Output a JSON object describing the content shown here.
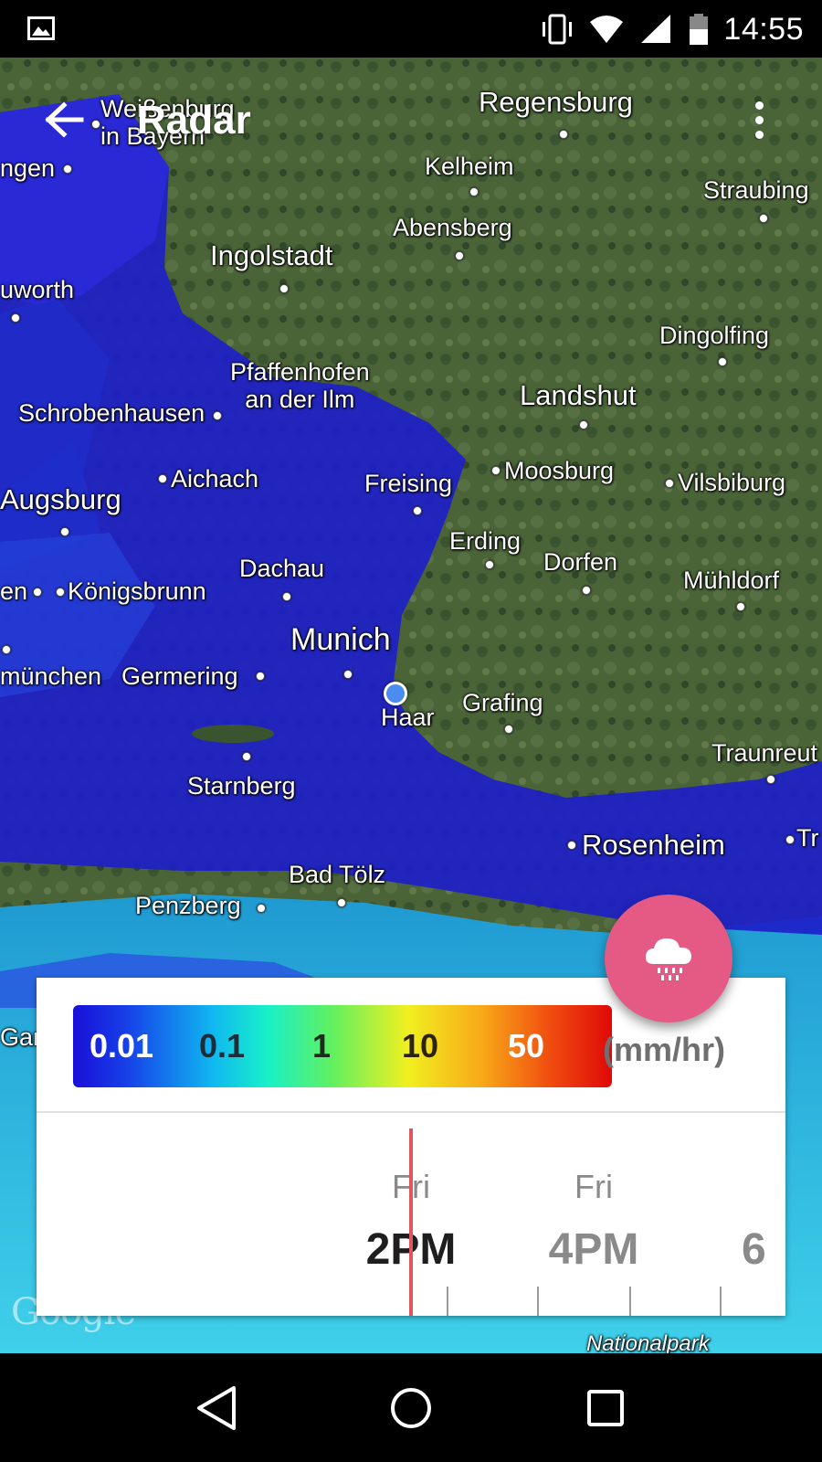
{
  "status_bar": {
    "time": "14:55",
    "icons": [
      "image-icon",
      "vibrate-icon",
      "wifi-icon",
      "signal-icon",
      "battery-icon"
    ]
  },
  "app_bar": {
    "title": "Radar",
    "back_icon": "arrow-left-icon",
    "menu_icon": "more-vert-icon"
  },
  "map": {
    "places": [
      {
        "id": "weissenburg",
        "label": "Weißenburg\nin Bayern"
      },
      {
        "id": "regensburg",
        "label": "Regensburg"
      },
      {
        "id": "kelheim",
        "label": "Kelheim"
      },
      {
        "id": "straubing",
        "label": "Straubing"
      },
      {
        "id": "ngen",
        "label": "ngen"
      },
      {
        "id": "abensberg",
        "label": "Abensberg"
      },
      {
        "id": "ingolstadt",
        "label": "Ingolstadt"
      },
      {
        "id": "uworth",
        "label": "uworth"
      },
      {
        "id": "dingolfing",
        "label": "Dingolfing"
      },
      {
        "id": "pfaffenhofen",
        "label": "Pfaffenhofen\nan der Ilm"
      },
      {
        "id": "landshut",
        "label": "Landshut"
      },
      {
        "id": "schrobenhausen",
        "label": "Schrobenhausen"
      },
      {
        "id": "aichach",
        "label": "Aichach"
      },
      {
        "id": "freising",
        "label": "Freising"
      },
      {
        "id": "moosburg",
        "label": "Moosburg"
      },
      {
        "id": "vilsbiburg",
        "label": "Vilsbiburg"
      },
      {
        "id": "augsburg",
        "label": "Augsburg"
      },
      {
        "id": "erding",
        "label": "Erding"
      },
      {
        "id": "dorfen",
        "label": "Dorfen"
      },
      {
        "id": "dachau",
        "label": "Dachau"
      },
      {
        "id": "muhldorf",
        "label": "Mühldorf"
      },
      {
        "id": "en",
        "label": "en"
      },
      {
        "id": "konigsbrunn",
        "label": "Königsbrunn"
      },
      {
        "id": "munich",
        "label": "Munich"
      },
      {
        "id": "munchen",
        "label": "münchen"
      },
      {
        "id": "germering",
        "label": "Germering"
      },
      {
        "id": "haar",
        "label": "Haar"
      },
      {
        "id": "grafing",
        "label": "Grafing"
      },
      {
        "id": "traunreut",
        "label": "Traunreut"
      },
      {
        "id": "starnberg",
        "label": "Starnberg"
      },
      {
        "id": "rosenheim",
        "label": "Rosenheim"
      },
      {
        "id": "tr",
        "label": "Tr"
      },
      {
        "id": "badtolz",
        "label": "Bad Tölz"
      },
      {
        "id": "penzberg",
        "label": "Penzberg"
      },
      {
        "id": "gar",
        "label": "Gar"
      },
      {
        "id": "nationalpark",
        "label": "Nationalpark"
      }
    ],
    "attribution": "Google"
  },
  "fab": {
    "icon": "rain-cloud-icon"
  },
  "legend": {
    "values": [
      "0.01",
      "0.1",
      "1",
      "10",
      "50"
    ],
    "unit": "(mm/hr)",
    "colors": [
      "#1a0fd8",
      "#10b8f0",
      "#60f060",
      "#f0f020",
      "#e00808"
    ]
  },
  "timeline": {
    "slots": [
      {
        "day": "Fri",
        "hour": "2PM",
        "current": true
      },
      {
        "day": "Fri",
        "hour": "4PM",
        "current": false
      },
      {
        "day": "",
        "hour": "6",
        "current": false
      }
    ],
    "accent_color": "#e05560"
  },
  "nav_bar": {
    "icons": [
      "nav-back-icon",
      "nav-home-icon",
      "nav-recents-icon"
    ]
  }
}
